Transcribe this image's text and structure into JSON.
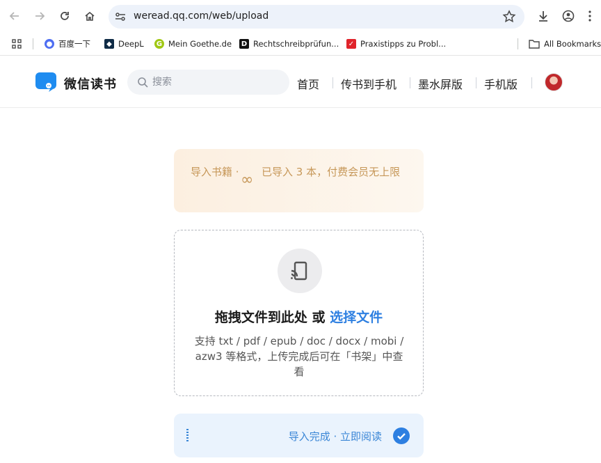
{
  "browser": {
    "url": "weread.qq.com/web/upload",
    "bookmarks": [
      {
        "label": "百度一下",
        "icon": "baidu-icon"
      },
      {
        "label": "DeepL",
        "icon": "deepl-icon"
      },
      {
        "label": "Mein Goethe.de",
        "icon": "goethe-icon"
      },
      {
        "label": "Rechtschreibprüfun...",
        "icon": "duden-icon"
      },
      {
        "label": "Praxistipps zu Probl...",
        "icon": "praxistipps-icon"
      }
    ],
    "all_bookmarks": "All Bookmarks"
  },
  "site": {
    "logo_text": "微信读书",
    "search_placeholder": "搜索",
    "nav": [
      "首页",
      "传书到手机",
      "墨水屏版",
      "手机版"
    ]
  },
  "notice": {
    "label": "导入书籍 ·",
    "symbol": "∞",
    "text": "已导入 3 本，付费会员无上限"
  },
  "dropzone": {
    "title_prefix": "拖拽文件到此处 或 ",
    "title_link": "选择文件",
    "description": "支持 txt / pdf / epub / doc / docx / mobi / azw3 等格式，上传完成后可在「书架」中查看"
  },
  "completion": {
    "text": "导入完成 · 立即阅读"
  },
  "colors": {
    "accent": "#2d7fe1",
    "notice_text": "#c69758",
    "completion_bg": "#eaf3fd"
  }
}
